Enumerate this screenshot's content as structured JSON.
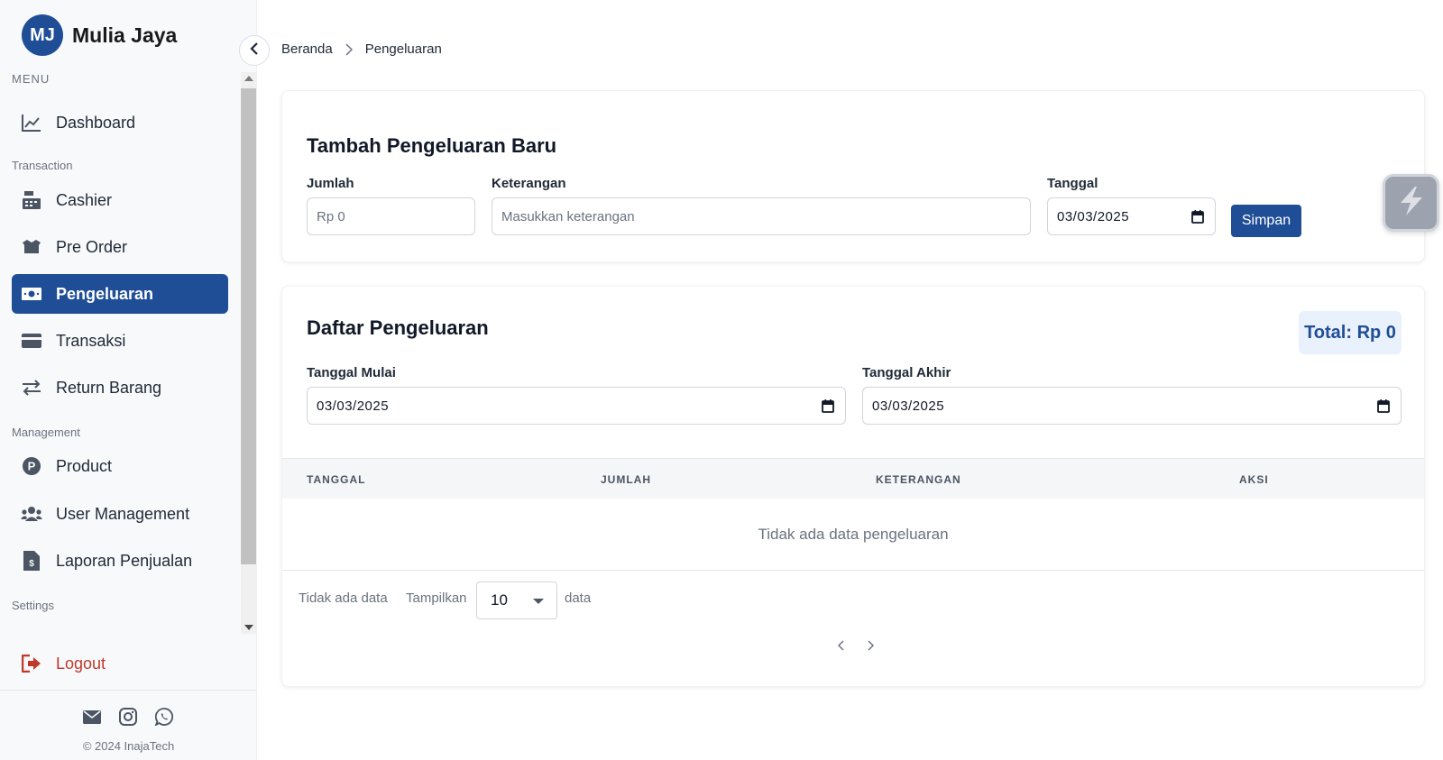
{
  "brand": {
    "initials": "MJ",
    "name": "Mulia Jaya"
  },
  "sidebar": {
    "menu_label": "MENU",
    "dashboard": "Dashboard",
    "transaction_label": "Transaction",
    "cashier": "Cashier",
    "pre_order": "Pre Order",
    "pengeluaran": "Pengeluaran",
    "transaksi": "Transaksi",
    "return_barang": "Return Barang",
    "management_label": "Management",
    "product": "Product",
    "user_management": "User Management",
    "laporan": "Laporan Penjualan",
    "settings_label": "Settings",
    "logout": "Logout",
    "copyright": "© 2024 InajaTech"
  },
  "breadcrumb": {
    "home": "Beranda",
    "current": "Pengeluaran"
  },
  "form": {
    "title": "Tambah Pengeluaran Baru",
    "jumlah_label": "Jumlah",
    "jumlah_placeholder": "Rp 0",
    "keterangan_label": "Keterangan",
    "keterangan_placeholder": "Masukkan keterangan",
    "tanggal_label": "Tanggal",
    "tanggal_value": "03/03/2025",
    "save_label": "Simpan"
  },
  "list": {
    "title": "Daftar Pengeluaran",
    "total": "Total: Rp 0",
    "start_label": "Tanggal Mulai",
    "start_value": "03/03/2025",
    "end_label": "Tanggal Akhir",
    "end_value": "03/03/2025",
    "columns": [
      "TANGGAL",
      "JUMLAH",
      "KETERANGAN",
      "AKSI"
    ],
    "empty_text": "Tidak ada data pengeluaran",
    "no_data": "Tidak ada data",
    "show_label": "Tampilkan",
    "page_size": "10",
    "data_label": "data"
  },
  "colors": {
    "primary": "#1f4e96",
    "logout": "#c0392b"
  }
}
